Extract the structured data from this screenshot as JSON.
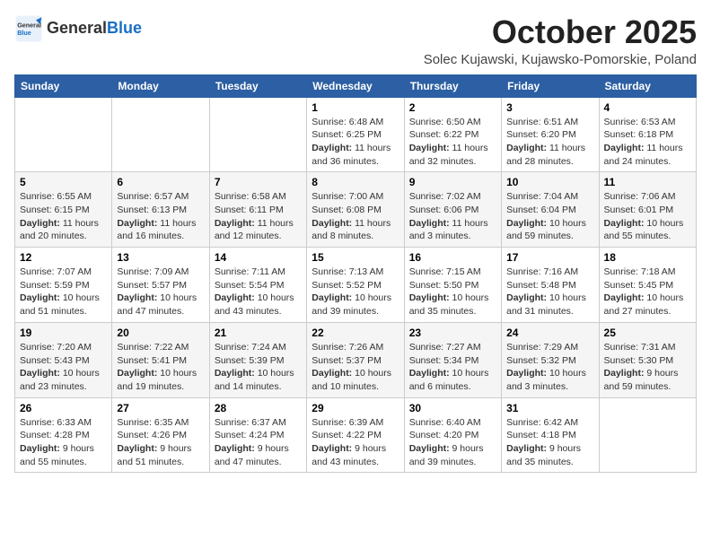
{
  "logo": {
    "general": "General",
    "blue": "Blue"
  },
  "header": {
    "month": "October 2025",
    "location": "Solec Kujawski, Kujawsko-Pomorskie, Poland"
  },
  "weekdays": [
    "Sunday",
    "Monday",
    "Tuesday",
    "Wednesday",
    "Thursday",
    "Friday",
    "Saturday"
  ],
  "weeks": [
    [
      {
        "day": "",
        "info": ""
      },
      {
        "day": "",
        "info": ""
      },
      {
        "day": "",
        "info": ""
      },
      {
        "day": "1",
        "info": "Sunrise: 6:48 AM\nSunset: 6:25 PM\nDaylight: 11 hours\nand 36 minutes."
      },
      {
        "day": "2",
        "info": "Sunrise: 6:50 AM\nSunset: 6:22 PM\nDaylight: 11 hours\nand 32 minutes."
      },
      {
        "day": "3",
        "info": "Sunrise: 6:51 AM\nSunset: 6:20 PM\nDaylight: 11 hours\nand 28 minutes."
      },
      {
        "day": "4",
        "info": "Sunrise: 6:53 AM\nSunset: 6:18 PM\nDaylight: 11 hours\nand 24 minutes."
      }
    ],
    [
      {
        "day": "5",
        "info": "Sunrise: 6:55 AM\nSunset: 6:15 PM\nDaylight: 11 hours\nand 20 minutes."
      },
      {
        "day": "6",
        "info": "Sunrise: 6:57 AM\nSunset: 6:13 PM\nDaylight: 11 hours\nand 16 minutes."
      },
      {
        "day": "7",
        "info": "Sunrise: 6:58 AM\nSunset: 6:11 PM\nDaylight: 11 hours\nand 12 minutes."
      },
      {
        "day": "8",
        "info": "Sunrise: 7:00 AM\nSunset: 6:08 PM\nDaylight: 11 hours\nand 8 minutes."
      },
      {
        "day": "9",
        "info": "Sunrise: 7:02 AM\nSunset: 6:06 PM\nDaylight: 11 hours\nand 3 minutes."
      },
      {
        "day": "10",
        "info": "Sunrise: 7:04 AM\nSunset: 6:04 PM\nDaylight: 10 hours\nand 59 minutes."
      },
      {
        "day": "11",
        "info": "Sunrise: 7:06 AM\nSunset: 6:01 PM\nDaylight: 10 hours\nand 55 minutes."
      }
    ],
    [
      {
        "day": "12",
        "info": "Sunrise: 7:07 AM\nSunset: 5:59 PM\nDaylight: 10 hours\nand 51 minutes."
      },
      {
        "day": "13",
        "info": "Sunrise: 7:09 AM\nSunset: 5:57 PM\nDaylight: 10 hours\nand 47 minutes."
      },
      {
        "day": "14",
        "info": "Sunrise: 7:11 AM\nSunset: 5:54 PM\nDaylight: 10 hours\nand 43 minutes."
      },
      {
        "day": "15",
        "info": "Sunrise: 7:13 AM\nSunset: 5:52 PM\nDaylight: 10 hours\nand 39 minutes."
      },
      {
        "day": "16",
        "info": "Sunrise: 7:15 AM\nSunset: 5:50 PM\nDaylight: 10 hours\nand 35 minutes."
      },
      {
        "day": "17",
        "info": "Sunrise: 7:16 AM\nSunset: 5:48 PM\nDaylight: 10 hours\nand 31 minutes."
      },
      {
        "day": "18",
        "info": "Sunrise: 7:18 AM\nSunset: 5:45 PM\nDaylight: 10 hours\nand 27 minutes."
      }
    ],
    [
      {
        "day": "19",
        "info": "Sunrise: 7:20 AM\nSunset: 5:43 PM\nDaylight: 10 hours\nand 23 minutes."
      },
      {
        "day": "20",
        "info": "Sunrise: 7:22 AM\nSunset: 5:41 PM\nDaylight: 10 hours\nand 19 minutes."
      },
      {
        "day": "21",
        "info": "Sunrise: 7:24 AM\nSunset: 5:39 PM\nDaylight: 10 hours\nand 14 minutes."
      },
      {
        "day": "22",
        "info": "Sunrise: 7:26 AM\nSunset: 5:37 PM\nDaylight: 10 hours\nand 10 minutes."
      },
      {
        "day": "23",
        "info": "Sunrise: 7:27 AM\nSunset: 5:34 PM\nDaylight: 10 hours\nand 6 minutes."
      },
      {
        "day": "24",
        "info": "Sunrise: 7:29 AM\nSunset: 5:32 PM\nDaylight: 10 hours\nand 3 minutes."
      },
      {
        "day": "25",
        "info": "Sunrise: 7:31 AM\nSunset: 5:30 PM\nDaylight: 9 hours\nand 59 minutes."
      }
    ],
    [
      {
        "day": "26",
        "info": "Sunrise: 6:33 AM\nSunset: 4:28 PM\nDaylight: 9 hours\nand 55 minutes."
      },
      {
        "day": "27",
        "info": "Sunrise: 6:35 AM\nSunset: 4:26 PM\nDaylight: 9 hours\nand 51 minutes."
      },
      {
        "day": "28",
        "info": "Sunrise: 6:37 AM\nSunset: 4:24 PM\nDaylight: 9 hours\nand 47 minutes."
      },
      {
        "day": "29",
        "info": "Sunrise: 6:39 AM\nSunset: 4:22 PM\nDaylight: 9 hours\nand 43 minutes."
      },
      {
        "day": "30",
        "info": "Sunrise: 6:40 AM\nSunset: 4:20 PM\nDaylight: 9 hours\nand 39 minutes."
      },
      {
        "day": "31",
        "info": "Sunrise: 6:42 AM\nSunset: 4:18 PM\nDaylight: 9 hours\nand 35 minutes."
      },
      {
        "day": "",
        "info": ""
      }
    ]
  ]
}
